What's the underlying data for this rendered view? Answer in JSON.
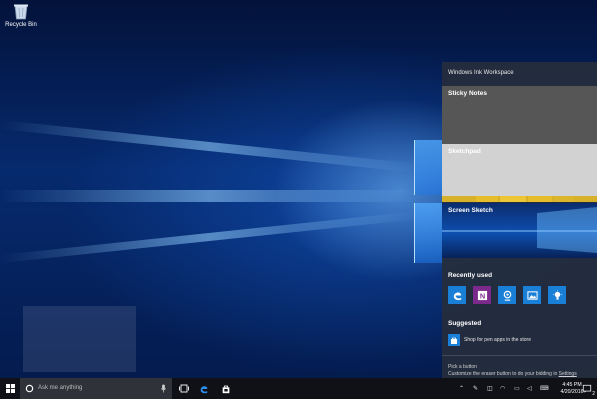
{
  "desktop": {
    "recycle_bin_label": "Recycle Bin"
  },
  "ink_workspace": {
    "title": "Windows Ink Workspace",
    "cards": {
      "sticky_notes": "Sticky Notes",
      "sketchpad": "Sketchpad",
      "screen_sketch": "Screen Sketch"
    },
    "recently_used_label": "Recently used",
    "recent_apps": [
      "edge-icon",
      "onenote-icon",
      "maps-icon",
      "photos-icon",
      "lightbulb-icon"
    ],
    "suggested_label": "Suggested",
    "suggested_item": "Shop for pen apps in the store",
    "tip_title": "Pick a button",
    "tip_body": "Customize the eraser button to do your bidding in",
    "tip_link": "Settings"
  },
  "taskbar": {
    "search_placeholder": "Ask me anything",
    "time": "4:45 PM",
    "date": "4/20/2016",
    "notification_count": "2"
  },
  "colors": {
    "accent": "#1a7fd6",
    "sticky_yellow": "#e5bd2b",
    "taskbar": "#0f1117"
  }
}
